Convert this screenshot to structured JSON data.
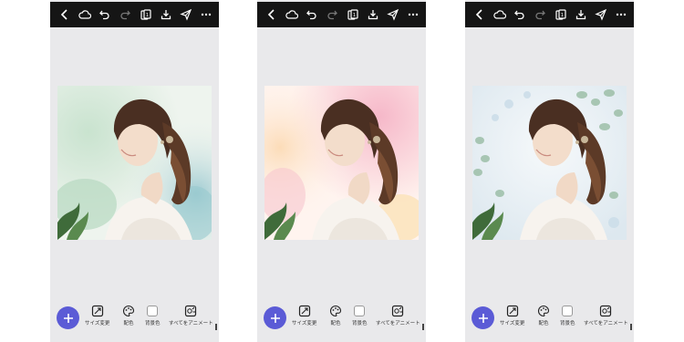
{
  "toolbar": {
    "icons": [
      "back-icon",
      "cloud-icon",
      "undo-icon",
      "redo-icon",
      "pages-icon",
      "download-icon",
      "share-icon",
      "more-icon"
    ]
  },
  "tools": {
    "resize": "サイズ変更",
    "color": "配色",
    "background": "背景色",
    "animate": "すべてをアニメート"
  },
  "fab": {
    "icon": "plus-icon"
  },
  "variants": [
    {
      "name": "green-watercolor",
      "colors": [
        "#d8eadb",
        "#bfe0c8",
        "#a9d4d6",
        "#f4f6f2"
      ]
    },
    {
      "name": "pink-watercolor",
      "colors": [
        "#f7d3da",
        "#fce7c8",
        "#f5b9c8",
        "#fff6f2"
      ]
    },
    {
      "name": "eucalyptus",
      "colors": [
        "#e3edf3",
        "#c5d9cc",
        "#9bbfa7",
        "#f5f8fa"
      ]
    }
  ],
  "accent": "#5b5bd6",
  "topbar_color": "#151515"
}
